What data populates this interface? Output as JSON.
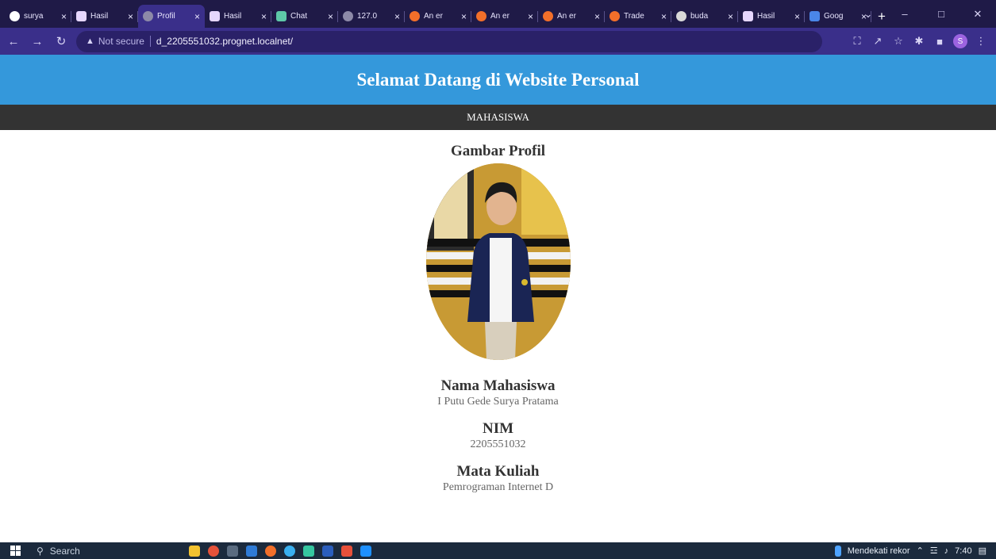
{
  "browser": {
    "tabs": [
      {
        "title": "surya",
        "icon": "github-icon",
        "active": false
      },
      {
        "title": "Hasil",
        "icon": "hasil-icon",
        "active": false
      },
      {
        "title": "Profil",
        "icon": "globe-icon",
        "active": true
      },
      {
        "title": "Hasil",
        "icon": "hasil-icon",
        "active": false
      },
      {
        "title": "Chat",
        "icon": "chat-icon",
        "active": false
      },
      {
        "title": "127.0",
        "icon": "globe-icon",
        "active": false
      },
      {
        "title": "An er",
        "icon": "pac-icon",
        "active": false
      },
      {
        "title": "An er",
        "icon": "pac-icon",
        "active": false
      },
      {
        "title": "An er",
        "icon": "pac-icon",
        "active": false
      },
      {
        "title": "Trade",
        "icon": "pac-icon",
        "active": false
      },
      {
        "title": "buda",
        "icon": "buda-icon",
        "active": false
      },
      {
        "title": "Hasil",
        "icon": "hasil-icon",
        "active": false
      },
      {
        "title": "Goog",
        "icon": "google-icon",
        "active": false
      }
    ],
    "not_secure_label": "Not secure",
    "url": "d_2205551032.prognet.localnet/",
    "profile_initial": "S"
  },
  "site": {
    "title": "Selamat Datang di Website Personal",
    "nav_link": "MAHASISWA",
    "profile_heading": "Gambar Profil",
    "name_label": "Nama Mahasiswa",
    "name_value": "I Putu Gede Surya Pratama",
    "nim_label": "NIM",
    "nim_value": "2205551032",
    "course_label": "Mata Kuliah",
    "course_value": "Pemrograman Internet D"
  },
  "taskbar": {
    "search_label": "Search",
    "weather_text": "Mendekati rekor",
    "time": "7:40"
  },
  "colors": {
    "header_bg": "#3498db",
    "nav_bg": "#333333",
    "browser_frame": "#1f1a47",
    "browser_toolbar": "#3a2f8a"
  }
}
